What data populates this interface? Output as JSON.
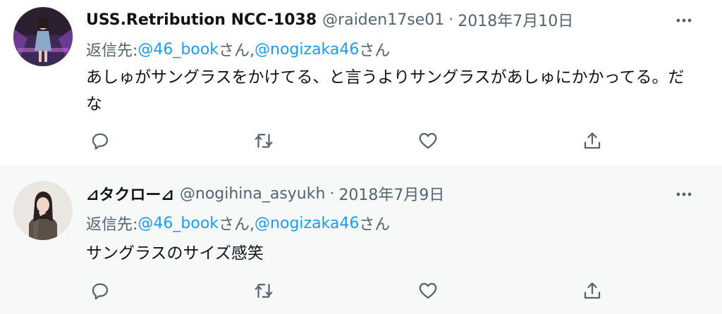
{
  "tweets": [
    {
      "name": "USS.Retribution NCC-1038",
      "handle": "@raiden17se01",
      "separator": "·",
      "date": "2018年7月10日",
      "reply_prefix": "返信先: ",
      "mention1": "@46_book",
      "mention1_suffix": "さん, ",
      "mention2": "@nogizaka46",
      "mention2_suffix": "さん",
      "text": "あしゅがサングラスをかけてる、と言うよりサングラスがあしゅにかかってる。だな"
    },
    {
      "name": "⊿タクロー⊿",
      "handle": "@nogihina_asyukh",
      "separator": "·",
      "date": "2018年7月9日",
      "reply_prefix": "返信先: ",
      "mention1": "@46_book",
      "mention1_suffix": "さん, ",
      "mention2": "@nogizaka46",
      "mention2_suffix": "さん",
      "text": "サングラスのサイズ感笑"
    }
  ],
  "icons": {
    "more": "more-horizontal-icon",
    "reply": "reply-bubble-icon",
    "retweet": "retweet-icon",
    "like": "heart-icon",
    "share": "share-upload-icon"
  },
  "colors": {
    "mention": "#1d9bf0",
    "secondary_text": "#536471",
    "primary_text": "#0f1419",
    "hover_background": "#f7f9f9"
  }
}
